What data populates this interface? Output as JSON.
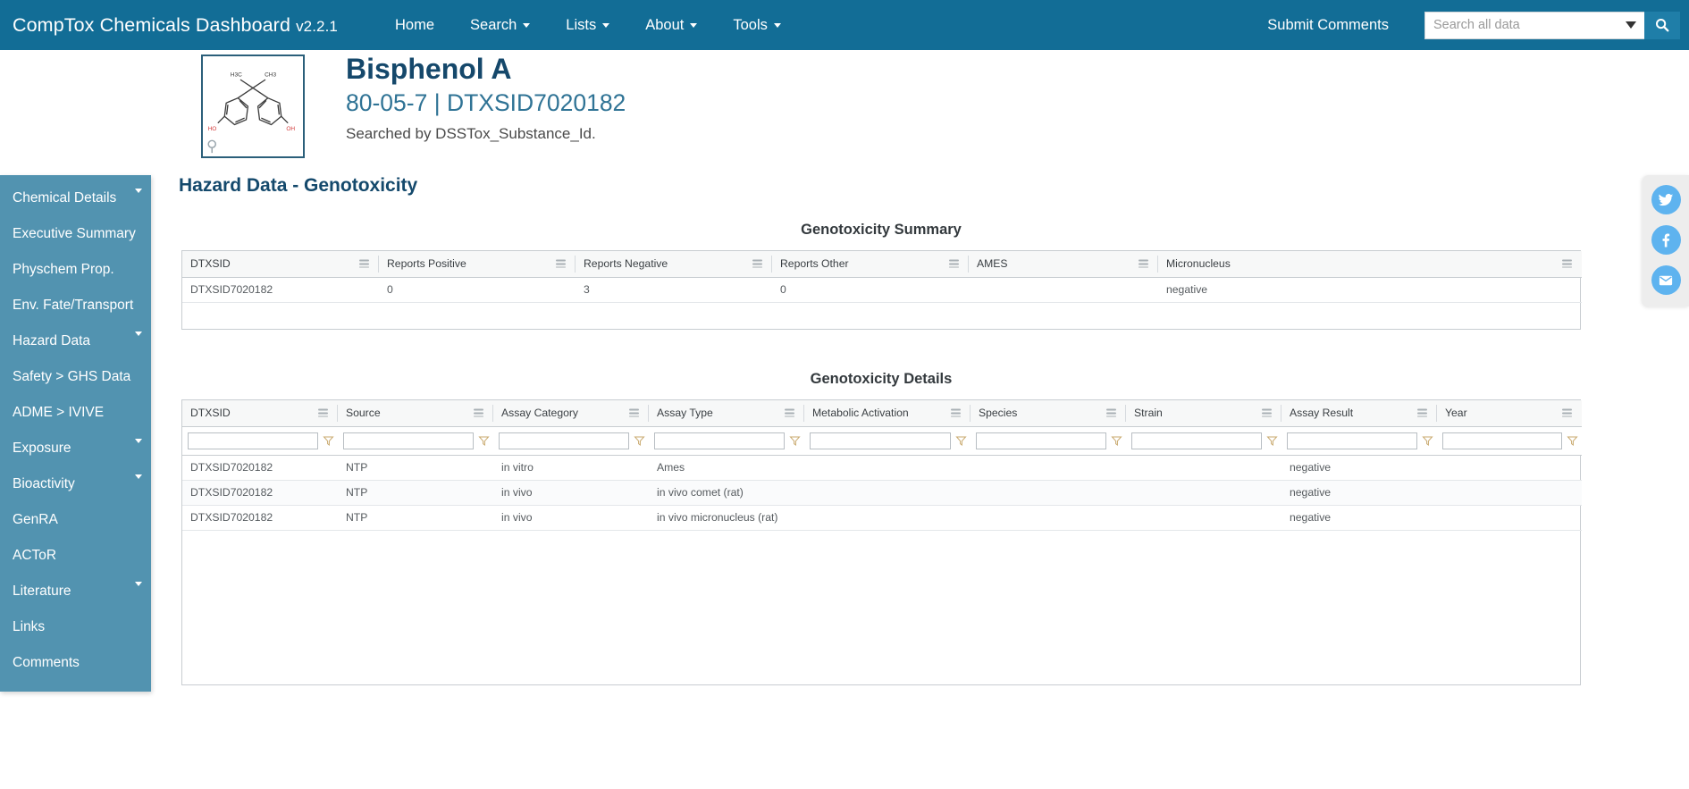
{
  "navbar": {
    "brand": "CompTox Chemicals Dashboard",
    "version": "v2.2.1",
    "links": [
      {
        "label": "Home",
        "caret": false
      },
      {
        "label": "Search",
        "caret": true
      },
      {
        "label": "Lists",
        "caret": true
      },
      {
        "label": "About",
        "caret": true
      },
      {
        "label": "Tools",
        "caret": true
      }
    ],
    "submit_comments": "Submit Comments",
    "search_placeholder": "Search all data",
    "search_value": "",
    "search_icon": "search-icon",
    "accent_color": "#126d96"
  },
  "chemical": {
    "name": "Bisphenol A",
    "identifiers": "80-05-7 | DTXSID7020182",
    "searched_by": "Searched by DSSTox_Substance_Id.",
    "structure_labels": {
      "methyl_left": "H3C",
      "methyl_right": "CH3",
      "hydroxy_left": "HO",
      "hydroxy_right": "OH"
    },
    "zoom_icon": "magnifier-icon"
  },
  "sidebar": {
    "background_color": "#5293b0",
    "items": [
      {
        "label": "Chemical Details",
        "caret": true
      },
      {
        "label": "Executive Summary",
        "caret": false
      },
      {
        "label": "Physchem Prop.",
        "caret": false
      },
      {
        "label": "Env. Fate/Transport",
        "caret": false
      },
      {
        "label": "Hazard Data",
        "caret": true
      },
      {
        "label": "Safety > GHS Data",
        "caret": false
      },
      {
        "label": "ADME > IVIVE",
        "caret": false
      },
      {
        "label": "Exposure",
        "caret": true
      },
      {
        "label": "Bioactivity",
        "caret": true
      },
      {
        "label": "GenRA",
        "caret": false
      },
      {
        "label": "ACToR",
        "caret": false
      },
      {
        "label": "Literature",
        "caret": true
      },
      {
        "label": "Links",
        "caret": false
      },
      {
        "label": "Comments",
        "caret": false
      }
    ]
  },
  "main": {
    "page_title": "Hazard Data - Genotoxicity",
    "summary": {
      "title": "Genotoxicity Summary",
      "columns": [
        "DTXSID",
        "Reports Positive",
        "Reports Negative",
        "Reports Other",
        "AMES",
        "Micronucleus"
      ],
      "rows": [
        [
          "DTXSID7020182",
          "0",
          "3",
          "0",
          "",
          "negative"
        ]
      ]
    },
    "details": {
      "title": "Genotoxicity Details",
      "columns": [
        "DTXSID",
        "Source",
        "Assay Category",
        "Assay Type",
        "Metabolic Activation",
        "Species",
        "Strain",
        "Assay Result",
        "Year"
      ],
      "filters": [
        "",
        "",
        "",
        "",
        "",
        "",
        "",
        "",
        ""
      ],
      "rows": [
        [
          "DTXSID7020182",
          "NTP",
          "in vitro",
          "Ames",
          "",
          "",
          "",
          "negative",
          ""
        ],
        [
          "DTXSID7020182",
          "NTP",
          "in vivo",
          "in vivo comet (rat)",
          "",
          "",
          "",
          "negative",
          ""
        ],
        [
          "DTXSID7020182",
          "NTP",
          "in vivo",
          "in vivo micronucleus (rat)",
          "",
          "",
          "",
          "negative",
          ""
        ]
      ]
    }
  },
  "social": {
    "buttons": [
      {
        "name": "twitter-icon"
      },
      {
        "name": "facebook-icon"
      },
      {
        "name": "email-icon"
      }
    ],
    "color": "#5eb3ef"
  }
}
